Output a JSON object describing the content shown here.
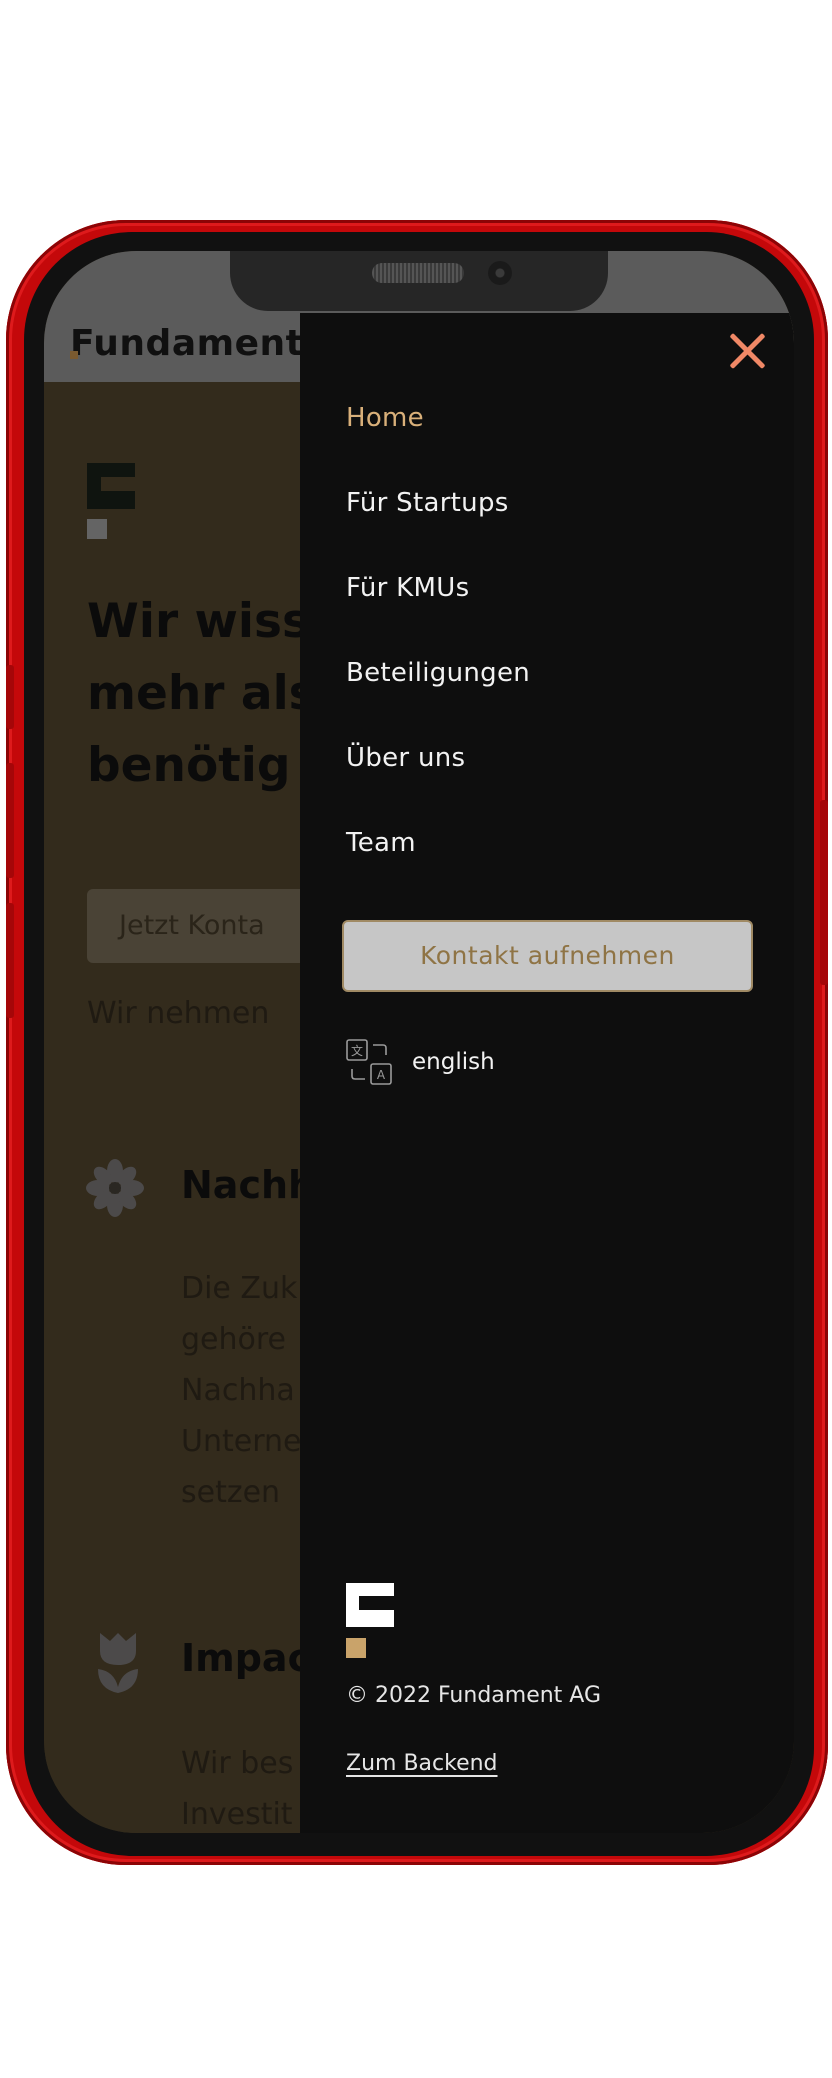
{
  "background_page": {
    "logo_text": "Fundament",
    "heading": "Wir wiss\nmehr als\nbenötig",
    "cta_button": "Jetzt Konta",
    "note": "Wir nehmen",
    "section_1": {
      "title": "Nachh",
      "text": "Die Zuk\ngehöre\nNachha\nUnterne\nsetzen"
    },
    "section_2": {
      "title": "Impac",
      "text": "Wir bes\nInvestit"
    }
  },
  "drawer": {
    "nav_items": [
      {
        "label": "Home",
        "active": true
      },
      {
        "label": "Für Startups",
        "active": false
      },
      {
        "label": "Für KMUs",
        "active": false
      },
      {
        "label": "Beteiligungen",
        "active": false
      },
      {
        "label": "Über uns",
        "active": false
      },
      {
        "label": "Team",
        "active": false
      }
    ],
    "cta_label": "Kontakt aufnehmen",
    "language_label": "english",
    "copyright": "© 2022 Fundament AG",
    "backend_link": "Zum Backend"
  },
  "icons": {
    "close": "close-icon",
    "language": "translate-icon",
    "logo_mark": "fundament-logo-icon",
    "sustainability": "flower-icon",
    "impact": "tulip-icon"
  },
  "colors": {
    "phone_frame": "#c4080a",
    "drawer_bg": "#0e0e0e",
    "accent_gold": "#d9b07a",
    "close_icon": "#f08866",
    "cta_bg": "#c6c6c6",
    "cta_text": "#8f7445"
  }
}
